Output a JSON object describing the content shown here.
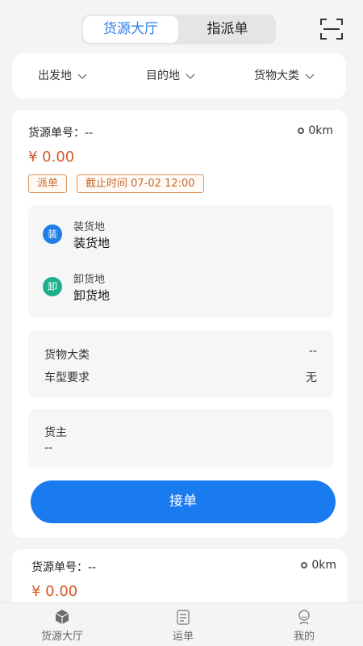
{
  "header": {
    "tabs": [
      "货源大厅",
      "指派单"
    ],
    "scan_icon": "scan-icon"
  },
  "filters": [
    {
      "label": "出发地"
    },
    {
      "label": "目的地"
    },
    {
      "label": "货物大类"
    }
  ],
  "orders": [
    {
      "order_no_label": "货源单号：--",
      "distance": "0km",
      "price": "¥ 0.00",
      "tags": [
        "派单",
        "截止时间 07-02 12:00"
      ],
      "load": {
        "icon_text": "装",
        "label": "装货地",
        "value": "装货地",
        "color": "#1f7ee8"
      },
      "unload": {
        "icon_text": "卸",
        "label": "卸货地",
        "value": "卸货地",
        "color": "#1fae8a"
      },
      "details": [
        {
          "key": "货物大类",
          "value": "--"
        },
        {
          "key": "车型要求",
          "value": "无"
        }
      ],
      "owner_label": "货主",
      "owner_value": "--",
      "accept_label": "接单"
    },
    {
      "order_no_label": "货源单号：--",
      "distance": "0km",
      "price": "¥ 0.00"
    }
  ],
  "tabbar": [
    {
      "label": "货源大厅",
      "icon": "box-icon"
    },
    {
      "label": "运单",
      "icon": "waybill-icon"
    },
    {
      "label": "我的",
      "icon": "profile-icon"
    }
  ],
  "colors": {
    "accent": "#1a7af0",
    "price": "#d2592b",
    "tag": "#c46a2e"
  }
}
